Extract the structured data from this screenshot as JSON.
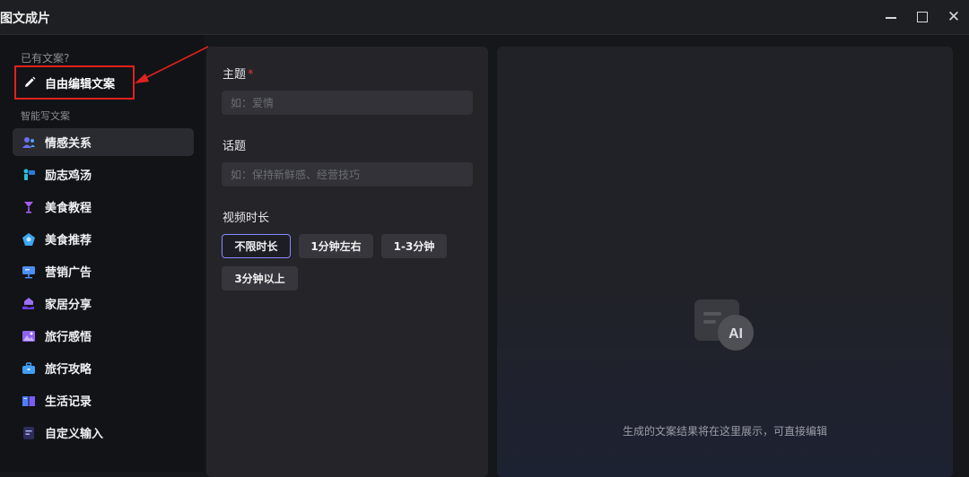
{
  "window": {
    "title": "图文成片"
  },
  "sidebar": {
    "existing_section_label": "已有文案?",
    "manual_edit_label": "自由编辑文案",
    "smart_section_label": "智能写文案",
    "items": [
      {
        "label": "情感关系",
        "icon": "people-icon",
        "color": "#6f6cf5"
      },
      {
        "label": "励志鸡汤",
        "icon": "teacher-icon",
        "color": "#28c0d8"
      },
      {
        "label": "美食教程",
        "icon": "wine-glass-icon",
        "color": "#a35cf2"
      },
      {
        "label": "美食推荐",
        "icon": "food-plate-icon",
        "color": "#3ea6f2"
      },
      {
        "label": "营销广告",
        "icon": "billboard-icon",
        "color": "#4b8ef5"
      },
      {
        "label": "家居分享",
        "icon": "hand-house-icon",
        "color": "#7b4cf0"
      },
      {
        "label": "旅行感悟",
        "icon": "landscape-icon",
        "color": "#8f63f2"
      },
      {
        "label": "旅行攻略",
        "icon": "suitcase-icon",
        "color": "#3f9ef5"
      },
      {
        "label": "生活记录",
        "icon": "book-icon",
        "color": "#4c7ff6"
      },
      {
        "label": "自定义输入",
        "icon": "document-icon",
        "color": "#5a5cf0"
      }
    ]
  },
  "form": {
    "topic_label": "主题",
    "topic_required_mark": "*",
    "topic_placeholder": "如：爱情",
    "subject_label": "话题",
    "subject_placeholder": "如：保持新鲜感、经营技巧",
    "duration_label": "视频时长",
    "duration_options": [
      "不限时长",
      "1分钟左右",
      "1-3分钟",
      "3分钟以上"
    ],
    "duration_selected": "不限时长"
  },
  "result": {
    "hint": "生成的文案结果将在这里展示，可直接编辑",
    "badge_text": "AI"
  },
  "colors": {
    "highlight_box": "#e0221d",
    "active_chip_border": "#8a88ff",
    "required_mark": "#e0373a"
  }
}
